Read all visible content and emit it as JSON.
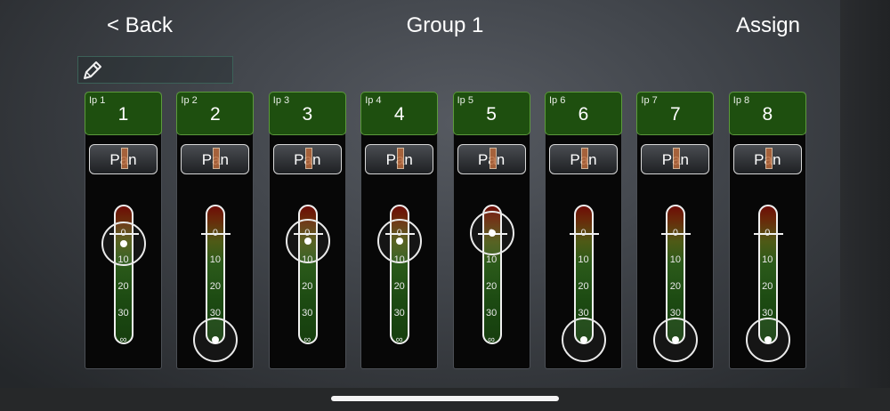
{
  "nav": {
    "back_label": "< Back",
    "title": "Group 1",
    "assign_label": "Assign"
  },
  "name_field": {
    "value": "",
    "icon": "pencil-icon"
  },
  "scale_ticks": [
    "0",
    "10",
    "20",
    "30",
    "∞"
  ],
  "pan_label": "Pan",
  "colors": {
    "channel_header_bg": "#1e4f0f",
    "channel_header_border": "#5c9a3c",
    "pan_indicator": "#b8683a"
  },
  "channels": [
    {
      "input_label": "Ip 1",
      "number": "1",
      "fader_db": 4
    },
    {
      "input_label": "Ip 2",
      "number": "2",
      "fader_db": "-∞"
    },
    {
      "input_label": "Ip 3",
      "number": "3",
      "fader_db": 3
    },
    {
      "input_label": "Ip 4",
      "number": "4",
      "fader_db": 3
    },
    {
      "input_label": "Ip 5",
      "number": "5",
      "fader_db": 0
    },
    {
      "input_label": "Ip 6",
      "number": "6",
      "fader_db": "-∞"
    },
    {
      "input_label": "Ip 7",
      "number": "7",
      "fader_db": "-∞"
    },
    {
      "input_label": "Ip 8",
      "number": "8",
      "fader_db": "-∞"
    }
  ]
}
